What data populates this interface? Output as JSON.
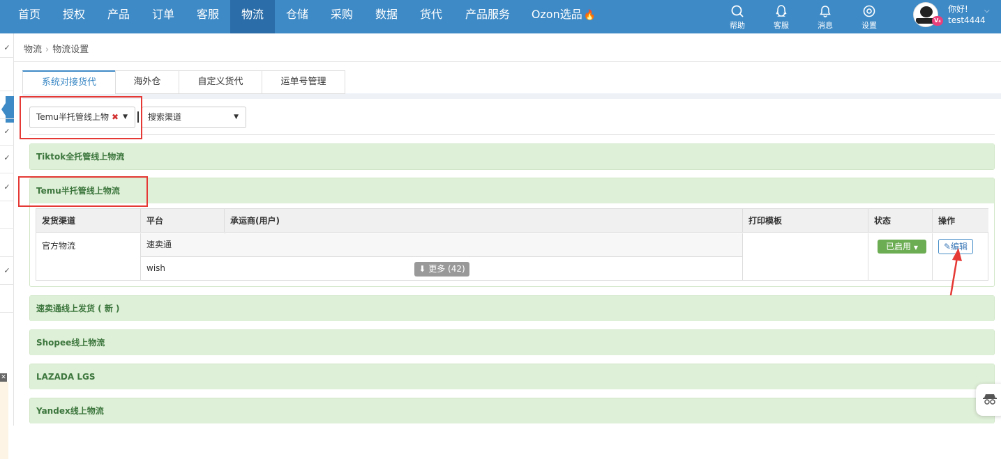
{
  "nav": {
    "items": [
      "首页",
      "授权",
      "产品",
      "订单",
      "客服",
      "物流",
      "仓储",
      "采购",
      "数据",
      "货代",
      "产品服务",
      "Ozon选品"
    ],
    "active_index": 5,
    "hot_item": "Ozon选品",
    "utilities": [
      {
        "label": "帮助",
        "icon": "search-icon"
      },
      {
        "label": "客服",
        "icon": "qq-icon"
      },
      {
        "label": "消息",
        "icon": "bell-icon"
      },
      {
        "label": "设置",
        "icon": "gear-icon"
      }
    ],
    "greeting": "你好!",
    "username": "test4444",
    "vip_badge": "V₄"
  },
  "breadcrumb": {
    "root": "物流",
    "current": "物流设置"
  },
  "tabs": [
    "系统对接货代",
    "海外仓",
    "自定义货代",
    "运单号管理"
  ],
  "active_tab": 0,
  "filters": {
    "selected_carrier": "Temu半托管线上物",
    "search_placeholder": "搜索渠道"
  },
  "panels": [
    {
      "title": "Tiktok全托管线上物流"
    },
    {
      "title": "Temu半托管线上物流"
    },
    {
      "title": "速卖通线上发货 ( 新 )"
    },
    {
      "title": "Shopee线上物流"
    },
    {
      "title": "LAZADA LGS"
    },
    {
      "title": "Yandex线上物流"
    }
  ],
  "table": {
    "headers": [
      "发货渠道",
      "平台",
      "承运商(用户)",
      "打印模板",
      "状态",
      "操作"
    ],
    "row": {
      "channel": "官方物流",
      "platforms": [
        "速卖通",
        "wish"
      ],
      "more_label": "更多 (42)",
      "status_label": "已启用",
      "edit_label": "编辑"
    }
  },
  "colors": {
    "nav_bg": "#3e8ac6",
    "nav_active": "#2b6da8",
    "panel_header": "#dff0d8",
    "panel_title": "#3c763d",
    "status_green": "#6cac53",
    "highlight_red": "#e53935"
  }
}
